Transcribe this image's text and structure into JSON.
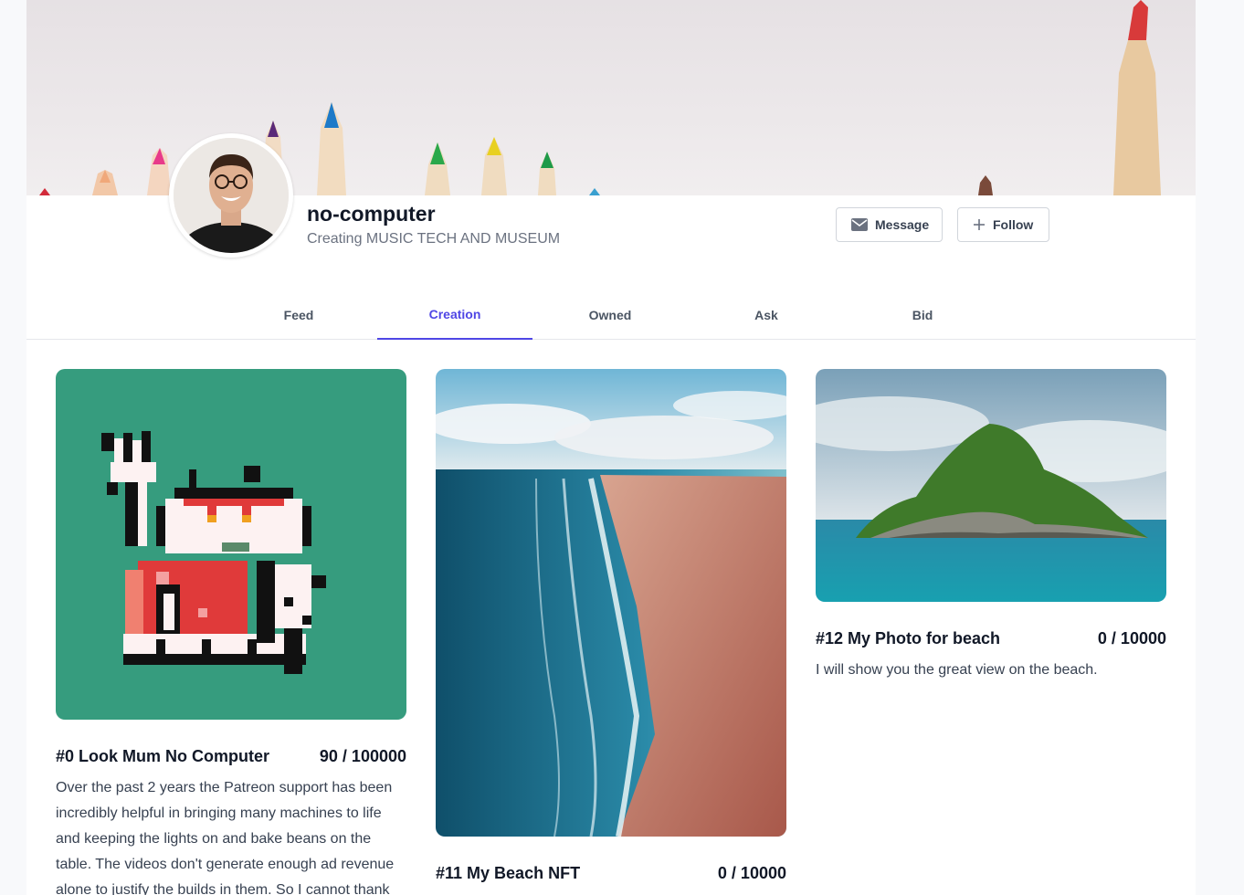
{
  "profile": {
    "name": "no-computer",
    "bio": "Creating MUSIC TECH AND MUSEUM"
  },
  "actions": {
    "message_label": "Message",
    "follow_label": "Follow"
  },
  "tabs": [
    {
      "label": "Feed",
      "active": false
    },
    {
      "label": "Creation",
      "active": true
    },
    {
      "label": "Owned",
      "active": false
    },
    {
      "label": "Ask",
      "active": false
    },
    {
      "label": "Bid",
      "active": false
    }
  ],
  "cards": [
    {
      "title": "#0 Look Mum No Computer",
      "count": "90 / 100000",
      "description": "Over the past 2 years the Patreon support has been incredibly helpful in bringing many machines to life and keeping the lights on and bake beans on the table. The videos don't generate enough ad revenue alone to justify the builds in them. So I cannot thank"
    },
    {
      "title": "#11 My Beach NFT",
      "count": "0 / 10000",
      "description": ""
    },
    {
      "title": "#12 My Photo for beach",
      "count": "0 / 10000",
      "description": "I will show you the great view on the beach."
    }
  ],
  "colors": {
    "accent": "#4f46e5",
    "nft_bg": "#369c7e"
  },
  "icons": {
    "message": "envelope-icon",
    "follow": "plus-icon"
  }
}
